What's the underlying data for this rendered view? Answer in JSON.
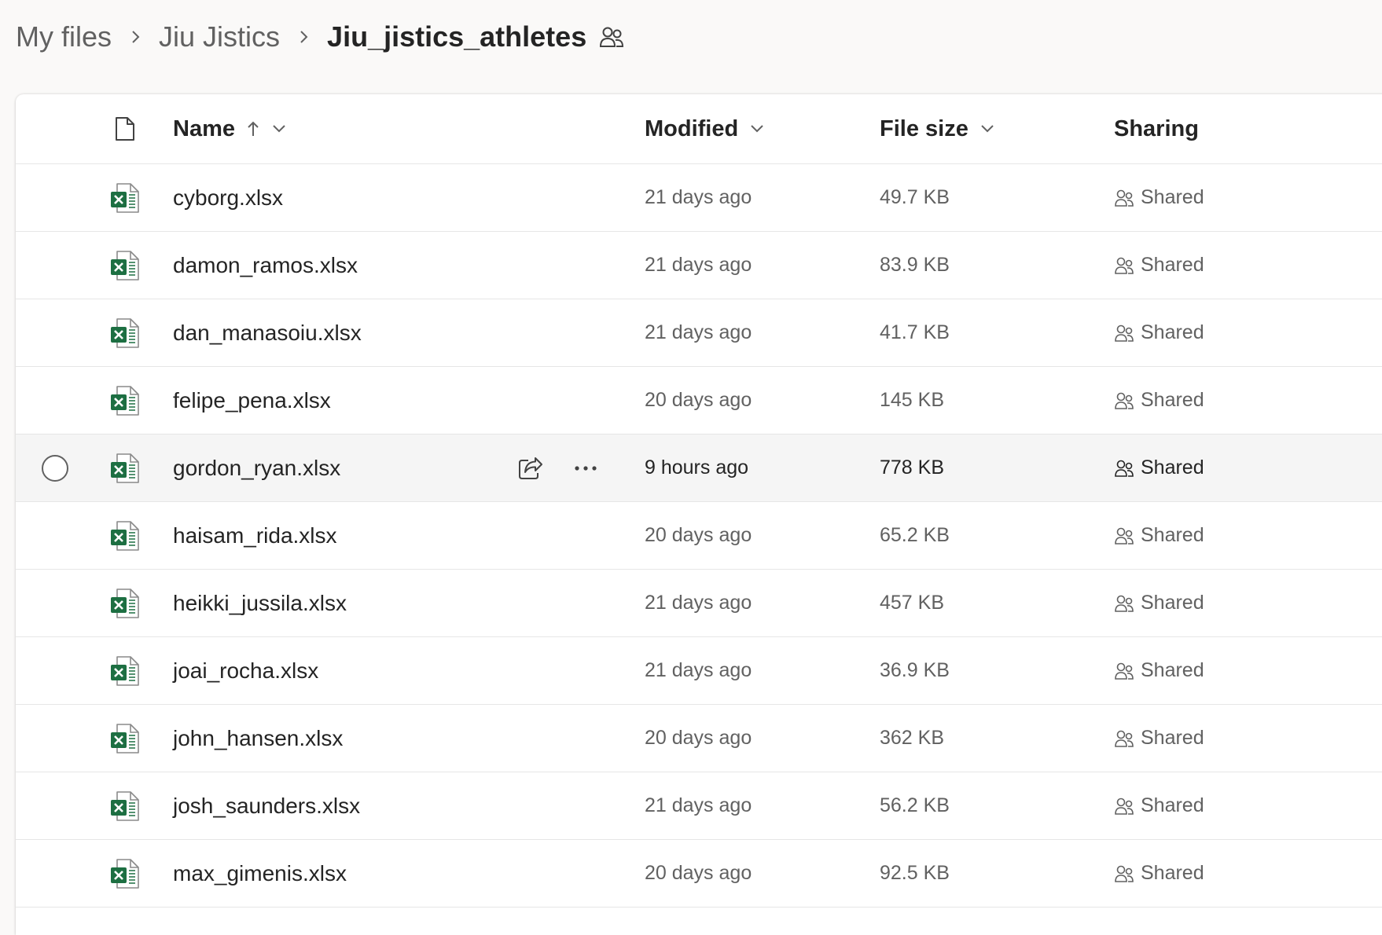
{
  "breadcrumb": {
    "items": [
      "My files",
      "Jiu Jistics"
    ],
    "current": "Jiu_jistics_athletes"
  },
  "columns": {
    "name": "Name",
    "modified": "Modified",
    "file_size": "File size",
    "sharing": "Sharing"
  },
  "sort": {
    "column": "Name",
    "direction": "ascending"
  },
  "files": [
    {
      "name": "cyborg.xlsx",
      "modified": "21 days ago",
      "size": "49.7 KB",
      "sharing": "Shared"
    },
    {
      "name": "damon_ramos.xlsx",
      "modified": "21 days ago",
      "size": "83.9 KB",
      "sharing": "Shared"
    },
    {
      "name": "dan_manasoiu.xlsx",
      "modified": "21 days ago",
      "size": "41.7 KB",
      "sharing": "Shared"
    },
    {
      "name": "felipe_pena.xlsx",
      "modified": "20 days ago",
      "size": "145 KB",
      "sharing": "Shared"
    },
    {
      "name": "gordon_ryan.xlsx",
      "modified": "9 hours ago",
      "size": "778 KB",
      "sharing": "Shared",
      "hovered": true
    },
    {
      "name": "haisam_rida.xlsx",
      "modified": "20 days ago",
      "size": "65.2 KB",
      "sharing": "Shared"
    },
    {
      "name": "heikki_jussila.xlsx",
      "modified": "21 days ago",
      "size": "457 KB",
      "sharing": "Shared"
    },
    {
      "name": "joai_rocha.xlsx",
      "modified": "21 days ago",
      "size": "36.9 KB",
      "sharing": "Shared"
    },
    {
      "name": "john_hansen.xlsx",
      "modified": "20 days ago",
      "size": "362 KB",
      "sharing": "Shared"
    },
    {
      "name": "josh_saunders.xlsx",
      "modified": "21 days ago",
      "size": "56.2 KB",
      "sharing": "Shared"
    },
    {
      "name": "max_gimenis.xlsx",
      "modified": "20 days ago",
      "size": "92.5 KB",
      "sharing": "Shared"
    }
  ],
  "icons": {
    "breadcrumb_separator": "chevron-right-icon",
    "shared_folder": "people-icon",
    "file_type_header": "document-icon",
    "file_type": "excel-file-icon",
    "sort": "arrow-up-icon",
    "dropdown": "chevron-down-icon",
    "share_action": "share-icon",
    "more_action": "more-horizontal-icon",
    "sharing_status": "people-icon"
  },
  "colors": {
    "excel_green": "#1d6f42",
    "row_hover": "#f5f5f5"
  }
}
